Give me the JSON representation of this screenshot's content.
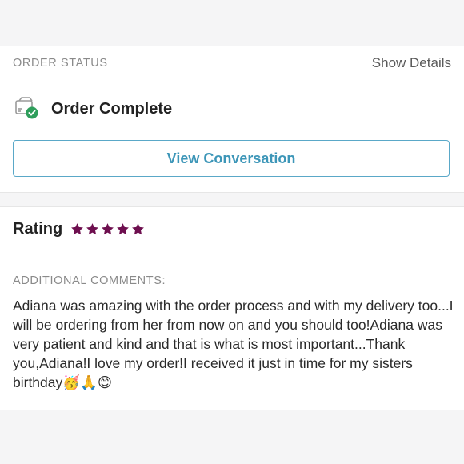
{
  "order_status": {
    "section_label": "ORDER STATUS",
    "show_details_label": "Show Details",
    "status_text": "Order Complete",
    "status_icon": "package-check-icon",
    "view_button_label": "View Conversation"
  },
  "rating": {
    "title": "Rating",
    "stars": 5,
    "max_stars": 5,
    "star_color": "#6e0f4f"
  },
  "comments": {
    "section_label": "ADDITIONAL COMMENTS:",
    "text": "Adiana was amazing with the order process and with my delivery too...I will be ordering from her from now on and you should too!Adiana was very patient and kind and that is what is most important...Thank you,Adiana!I love my order!I received it just in time for my sisters birthday🥳🙏😊"
  },
  "colors": {
    "accent": "#3d96b8",
    "success": "#2e9e5b",
    "label_gray": "#8a8a8a"
  }
}
